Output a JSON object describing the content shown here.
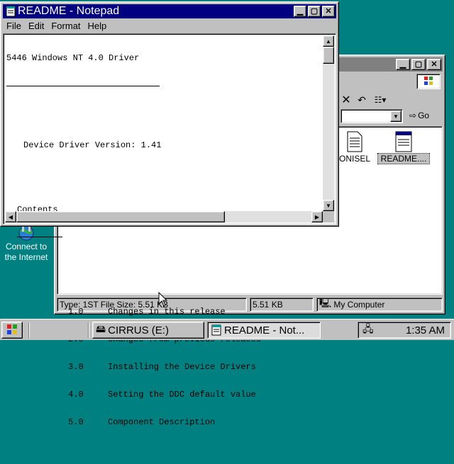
{
  "desktop": {
    "connect_label_line1": "Connect to",
    "connect_label_line2": "the Internet"
  },
  "explorer": {
    "address_go": "Go",
    "files": [
      {
        "name": "ONISEL"
      },
      {
        "name": "README...."
      }
    ],
    "status": {
      "info": "Type: 1ST File Size: 5.51 KB",
      "size": "5.51 KB",
      "zone": "My Computer"
    }
  },
  "notepad": {
    "title": "README - Notepad",
    "menu": [
      "File",
      "Edit",
      "Format",
      "Help"
    ],
    "content": {
      "heading": "5446 Windows NT 4.0 Driver",
      "version": "Device Driver Version: 1.41",
      "contents_title": "Contents",
      "toc": [
        {
          "num": "1.0",
          "text": "Changes in this release"
        },
        {
          "num": "2.0",
          "text": "Changes from previous releases"
        },
        {
          "num": "3.0",
          "text": "Installing the Device Drivers"
        },
        {
          "num": "4.0",
          "text": "Setting the DDC default value"
        },
        {
          "num": "5.0",
          "text": "Component Description"
        }
      ]
    }
  },
  "taskbar": {
    "tasks": [
      {
        "label": "CIRRUS (E:)"
      },
      {
        "label": "README - Not..."
      }
    ],
    "clock": "1:35 AM"
  },
  "colors": {
    "desktop": "#008080",
    "title_active": "#000080",
    "title_inactive": "#808080"
  }
}
